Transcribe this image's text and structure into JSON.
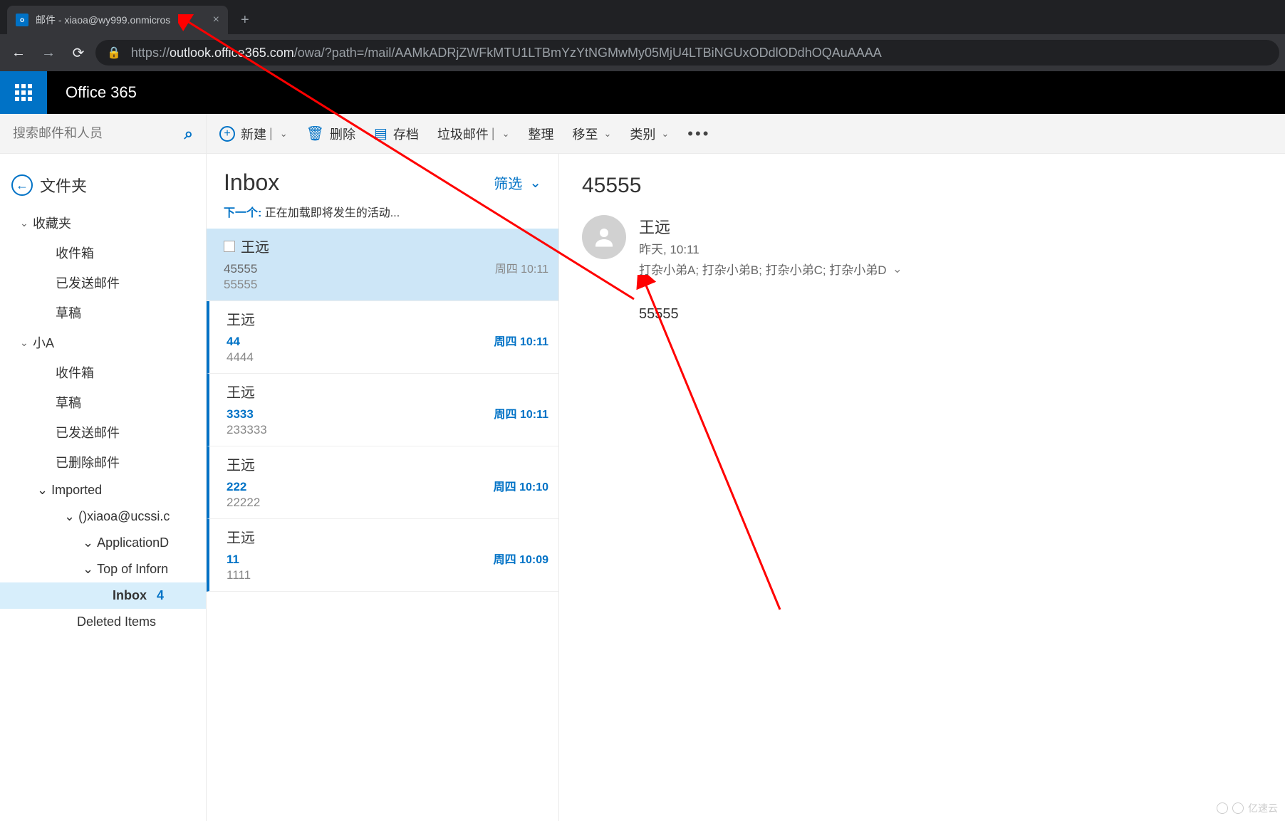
{
  "browser": {
    "tab_title": "邮件 - xiaoa@wy999.onmicros",
    "url_prefix": "https://",
    "url_host": "outlook.office365.com",
    "url_path": "/owa/?path=/mail/AAMkADRjZWFkMTU1LTBmYzYtNGMwMy05MjU4LTBiNGUxODdlODdhOQAuAAAA"
  },
  "suite": {
    "title": "Office 365"
  },
  "search": {
    "placeholder": "搜索邮件和人员"
  },
  "folders": {
    "header": "文件夹",
    "favorites": {
      "label": "收藏夹",
      "items": [
        "收件箱",
        "已发送邮件",
        "草稿"
      ]
    },
    "accountA": {
      "label": "小A",
      "items": [
        "收件箱",
        "草稿",
        "已发送邮件",
        "已删除邮件"
      ]
    },
    "imported": {
      "label": "Imported",
      "sub1": "()xiaoa@ucssi.c",
      "sub2": "ApplicationD",
      "sub3": "Top of Inforn",
      "inbox": {
        "label": "Inbox",
        "count": "4"
      },
      "deleted": "Deleted Items"
    }
  },
  "toolbar": {
    "new": "新建",
    "delete": "删除",
    "archive": "存档",
    "junk": "垃圾邮件",
    "sweep": "整理",
    "moveTo": "移至",
    "categories": "类别"
  },
  "list": {
    "title": "Inbox",
    "filter": "筛选",
    "next_label": "下一个:",
    "next_text": "正在加载即将发生的活动...",
    "messages": [
      {
        "from": "王远",
        "subject": "45555",
        "preview": "55555",
        "time": "周四 10:11",
        "selected": true,
        "unread": false,
        "checkbox": true
      },
      {
        "from": "王远",
        "subject": "44",
        "preview": "4444",
        "time": "周四 10:11",
        "selected": false,
        "unread": true
      },
      {
        "from": "王远",
        "subject": "3333",
        "preview": "233333",
        "time": "周四 10:11",
        "selected": false,
        "unread": true
      },
      {
        "from": "王远",
        "subject": "222",
        "preview": "22222",
        "time": "周四 10:10",
        "selected": false,
        "unread": true
      },
      {
        "from": "王远",
        "subject": "11",
        "preview": "1111",
        "time": "周四 10:09",
        "selected": false,
        "unread": true
      }
    ]
  },
  "reading": {
    "subject": "45555",
    "sender": "王远",
    "time": "昨天, 10:11",
    "recipients": "打杂小弟A; 打杂小弟B; 打杂小弟C; 打杂小弟D",
    "body": "55555"
  },
  "watermark": "亿速云"
}
